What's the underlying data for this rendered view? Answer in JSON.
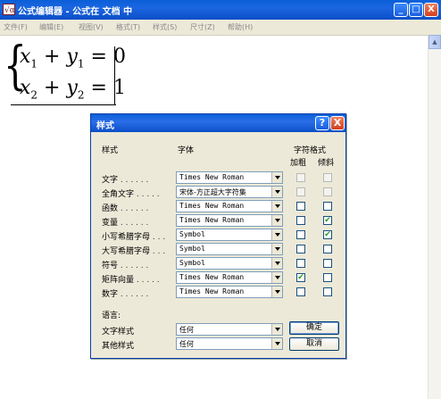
{
  "window": {
    "title": "公式编辑器 - 公式在 文档  中",
    "minimize": "_",
    "maximize": "□",
    "close": "X"
  },
  "menu": [
    {
      "label": "文件(F)"
    },
    {
      "label": "编辑(E)"
    },
    {
      "label": "视图(V)"
    },
    {
      "label": "格式(T)"
    },
    {
      "label": "样式(S)"
    },
    {
      "label": "尺寸(Z)"
    },
    {
      "label": "帮助(H)"
    }
  ],
  "equation": {
    "brace": "{",
    "line1": {
      "x": "x",
      "xsub": "1",
      "plus": " + ",
      "y": "y",
      "ysub": "1",
      "eq": " = ",
      "rhs": "0"
    },
    "line2": {
      "x": "x",
      "xsub": "2",
      "plus": " + ",
      "y": "y",
      "ysub": "2",
      "eq": " = ",
      "rhs": "1"
    }
  },
  "scrollbar": {
    "up_arrow": "▲"
  },
  "dialog": {
    "title": "样式",
    "help_label": "?",
    "close_label": "X",
    "headers": {
      "style": "样式",
      "font": "字体",
      "char_format": "字符格式",
      "bold": "加粗",
      "italic": "倾斜"
    },
    "rows": [
      {
        "label": "文字",
        "dots": " . . . . . .",
        "font": "Times New Roman",
        "bold": false,
        "italic": false
      },
      {
        "label": "全角文字",
        "dots": " . . . . .",
        "font": "宋体-方正超大字符集",
        "bold": false,
        "italic": false
      },
      {
        "label": "函数",
        "dots": " . . . . . .",
        "font": "Times New Roman",
        "bold": false,
        "italic": false
      },
      {
        "label": "变量",
        "dots": " . . . . . .",
        "font": "Times New Roman",
        "bold": false,
        "italic": true
      },
      {
        "label": "小写希腊字母",
        "dots": " . . .",
        "font": "Symbol",
        "bold": false,
        "italic": true
      },
      {
        "label": "大写希腊字母",
        "dots": " . . .",
        "font": "Symbol",
        "bold": false,
        "italic": false
      },
      {
        "label": "符号",
        "dots": " . . . . . .",
        "font": "Symbol",
        "bold": false,
        "italic": false
      },
      {
        "label": "矩阵向量",
        "dots": " . . . . .",
        "font": "Times New Roman",
        "bold": true,
        "italic": false
      },
      {
        "label": "数字",
        "dots": " . . . . . .",
        "font": "Times New Roman",
        "bold": false,
        "italic": false
      }
    ],
    "language": {
      "label": "语言:",
      "rows": [
        {
          "label": "文字样式",
          "value": "任何"
        },
        {
          "label": "其他样式",
          "value": "任何"
        }
      ]
    },
    "ok_label": "确定",
    "cancel_label": "取消",
    "check_mark": "✔"
  }
}
